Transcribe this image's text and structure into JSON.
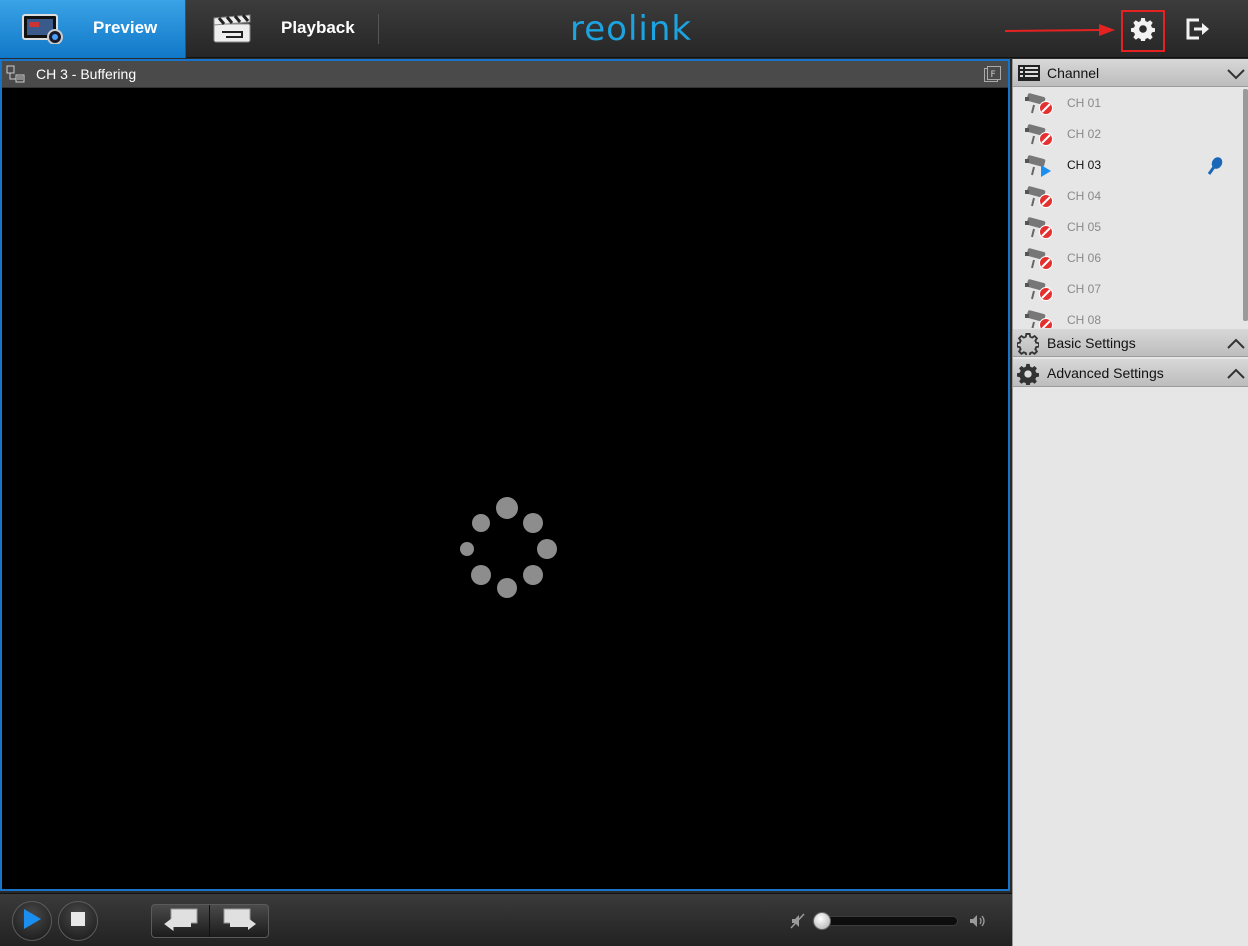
{
  "topbar": {
    "tabs": [
      {
        "label": "Preview",
        "active": true
      },
      {
        "label": "Playback",
        "active": false
      }
    ],
    "logo_text": "reolink",
    "icons": [
      "settings-gear-icon",
      "logout-icon"
    ]
  },
  "video": {
    "title": "CH 3 - Buffering",
    "state_icon": "loading-spinner-icon"
  },
  "controls": {
    "icons": [
      "play-icon",
      "stop-icon",
      "previous-icon",
      "next-icon",
      "mute-icon",
      "volume-icon"
    ],
    "volume_level": 0
  },
  "sidebar": {
    "channel_header": "Channel",
    "channels": [
      {
        "label": "CH 01",
        "online": false
      },
      {
        "label": "CH 02",
        "online": false
      },
      {
        "label": "CH 03",
        "online": true
      },
      {
        "label": "CH 04",
        "online": false
      },
      {
        "label": "CH 05",
        "online": false
      },
      {
        "label": "CH 06",
        "online": false
      },
      {
        "label": "CH 07",
        "online": false
      },
      {
        "label": "CH 08",
        "online": false
      }
    ],
    "basic_settings_header": "Basic Settings",
    "advanced_settings_header": "Advanced Settings"
  },
  "colors": {
    "accent_blue": "#1874c8",
    "logo_blue": "#1ca3e0",
    "highlight_red": "#e52222"
  }
}
